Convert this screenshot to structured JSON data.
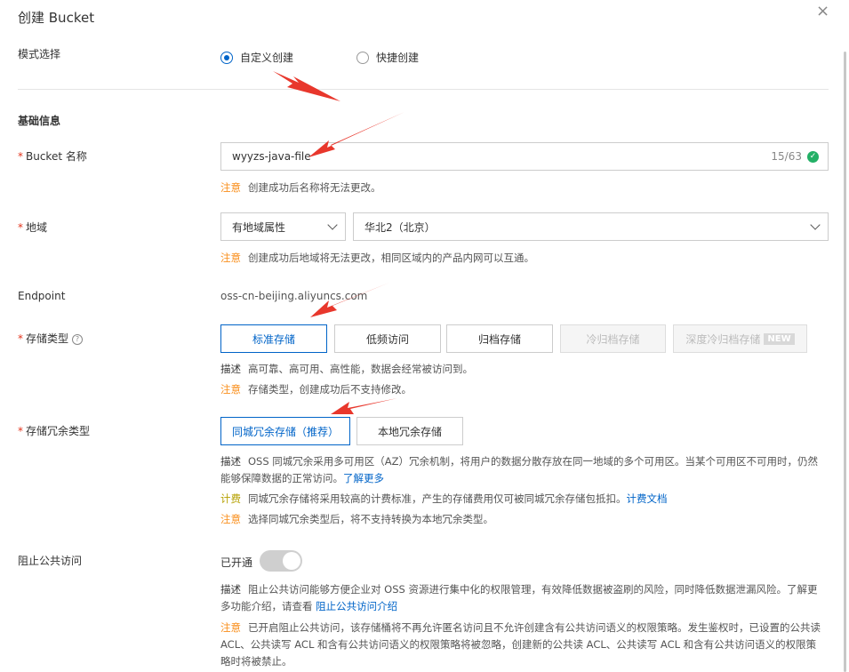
{
  "dialog": {
    "title": "创建 Bucket",
    "close_symbol": "×"
  },
  "mode": {
    "label": "模式选择",
    "options": [
      {
        "label": "自定义创建",
        "selected": true
      },
      {
        "label": "快捷创建",
        "selected": false
      }
    ]
  },
  "basic": {
    "section_title": "基础信息",
    "name": {
      "label": "Bucket 名称",
      "value": "wyyzs-java-file",
      "counter": "15/63",
      "note_tag": "注意",
      "note": "创建成功后名称将无法更改。"
    },
    "region": {
      "label": "地域",
      "type_select": "有地域属性",
      "region_select": "华北2（北京）",
      "note_tag": "注意",
      "note": "创建成功后地域将无法更改，相同区域内的产品内网可以互通。"
    },
    "endpoint": {
      "label": "Endpoint",
      "value": "oss-cn-beijing.aliyuncs.com"
    },
    "storage_class": {
      "label": "存储类型",
      "help_icon": "?",
      "options": [
        {
          "label": "标准存储",
          "state": "selected"
        },
        {
          "label": "低频访问",
          "state": "normal"
        },
        {
          "label": "归档存储",
          "state": "normal"
        },
        {
          "label": "冷归档存储",
          "state": "disabled"
        },
        {
          "label": "深度冷归档存储",
          "state": "disabled",
          "badge": "NEW"
        }
      ],
      "desc_tag": "描述",
      "desc": "高可靠、高可用、高性能，数据会经常被访问到。",
      "note_tag": "注意",
      "note": "存储类型，创建成功后不支持修改。"
    },
    "redundancy": {
      "label": "存储冗余类型",
      "options": [
        {
          "label": "同城冗余存储（推荐）",
          "state": "selected"
        },
        {
          "label": "本地冗余存储",
          "state": "normal"
        }
      ],
      "desc_tag": "描述",
      "desc": "OSS 同城冗余采用多可用区（AZ）冗余机制，将用户的数据分散存放在同一地域的多个可用区。当某个可用区不可用时，仍然能够保障数据的正常访问。",
      "desc_link": "了解更多",
      "bill_tag": "计费",
      "bill": "同城冗余存储将采用较高的计费标准，产生的存储费用仅可被同城冗余存储包抵扣。",
      "bill_link": "计费文档",
      "note_tag": "注意",
      "note": "选择同城冗余类型后，将不支持转换为本地冗余类型。"
    },
    "public_block": {
      "label": "阻止公共访问",
      "toggle_label": "已开通",
      "toggle_on": true,
      "desc_tag": "描述",
      "desc": "阻止公共访问能够方便企业对 OSS 资源进行集中化的权限管理，有效降低数据被盗刷的风险，同时降低数据泄漏风险。了解更多功能介绍，请查看",
      "desc_link": "阻止公共访问介绍",
      "note_tag": "注意",
      "note": "已开启阻止公共访问，该存储桶将不再允许匿名访问且不允许创建含有公共访问语义的权限策略。发生鉴权时，已设置的公共读 ACL、公共读写 ACL 和含有公共访问语义的权限策略将被忽略，创建新的公共读 ACL、公共读写 ACL 和含有公共访问语义的权限策略时将被禁止。"
    }
  },
  "colors": {
    "accent": "#0064c8",
    "warn": "#f98e1a",
    "arrow": "#e8372c",
    "success": "#23b066"
  }
}
